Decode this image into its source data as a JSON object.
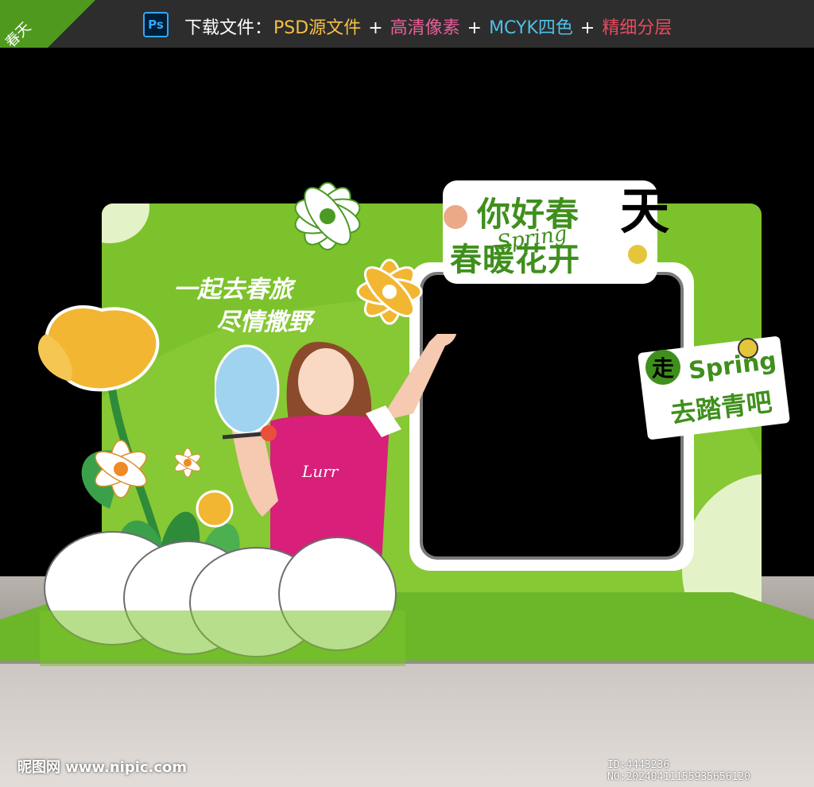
{
  "banner": {
    "corner_text": "春天",
    "ps_label": "Ps",
    "prefix": "下载文件：",
    "items": [
      {
        "text": "PSD源文件",
        "color": "#f5c043"
      },
      {
        "text": " + ",
        "color": "#ffffff"
      },
      {
        "text": "高清像素",
        "color": "#e95f9a"
      },
      {
        "text": " + ",
        "color": "#ffffff"
      },
      {
        "text": "MCYK四色",
        "color": "#4ec1e8"
      },
      {
        "text": " + ",
        "color": "#ffffff"
      },
      {
        "text": "精细分层",
        "color": "#e84a5f"
      }
    ]
  },
  "poster": {
    "title_line1": "你好春",
    "title_tian": "天",
    "title_line2": "春暖花开",
    "title_script": "Spring",
    "slogan_line1": "一起去春旅",
    "slogan_line2": "尽情撒野",
    "spring_card": {
      "zou": "走",
      "en": "Spring",
      "cn": "去踏青吧"
    },
    "shirt_script": "Lurr"
  },
  "watermark": {
    "left": "昵图网 www.nipic.com",
    "right": "ID:4443236 NO:20240411155935656120"
  },
  "colors": {
    "board": "#7cc22c",
    "title_green": "#3f8f1c",
    "accent_yellow": "#f2b632"
  }
}
